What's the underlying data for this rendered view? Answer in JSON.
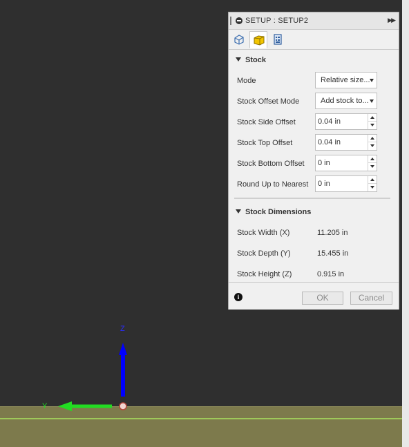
{
  "panel": {
    "title": "SETUP : SETUP2",
    "tabs": [
      {
        "name": "setup-tab",
        "icon": "cube-outline-icon"
      },
      {
        "name": "stock-tab",
        "icon": "yellow-cube-icon",
        "active": true
      },
      {
        "name": "post-process-tab",
        "icon": "program-sheet-icon"
      }
    ],
    "stock": {
      "heading": "Stock",
      "mode_label": "Mode",
      "mode_value": "Relative size...",
      "offset_mode_label": "Stock Offset Mode",
      "offset_mode_value": "Add stock to...",
      "side_offset_label": "Stock Side Offset",
      "side_offset_value": "0.04 in",
      "top_offset_label": "Stock Top Offset",
      "top_offset_value": "0.04 in",
      "bottom_offset_label": "Stock Bottom Offset",
      "bottom_offset_value": "0 in",
      "round_up_label": "Round Up to Nearest",
      "round_up_value": "0 in"
    },
    "dimensions": {
      "heading": "Stock Dimensions",
      "width_label": "Stock Width (X)",
      "width_value": "11.205 in",
      "depth_label": "Stock Depth (Y)",
      "depth_value": "15.455 in",
      "height_label": "Stock Height (Z)",
      "height_value": "0.915 in"
    },
    "footer": {
      "ok_label": "OK",
      "cancel_label": "Cancel"
    }
  },
  "viewport": {
    "z_axis_label": "Z",
    "y_axis_label": "Y",
    "colors": {
      "z_axis": "#0000ff",
      "y_axis": "#22dd22",
      "ground": "#7d7a4c",
      "ground_line": "#9ec95a",
      "background": "#2f2f2f"
    }
  }
}
